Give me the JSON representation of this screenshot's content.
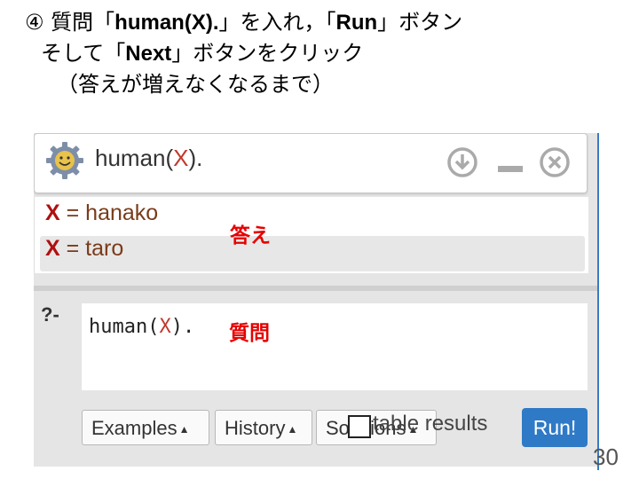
{
  "slide": {
    "step_mark": "④",
    "line1_a": "質問「",
    "line1_b": "human(X).",
    "line1_c": "」を入れ，「",
    "line1_d": "Run",
    "line1_e": "」ボタン",
    "line2_a": "そして「",
    "line2_b": "Next",
    "line2_c": "」ボタンをクリック",
    "line3": "（答えが増えなくなるまで）",
    "page_number": "30"
  },
  "query_header": {
    "pred": "human(",
    "var": "X",
    "close": ")."
  },
  "answers": [
    {
      "var": "X",
      "eq": " = hanako"
    },
    {
      "var": "X",
      "eq": " = taro"
    }
  ],
  "annotations": {
    "answer_tag": "答え",
    "question_tag": "質問"
  },
  "editor": {
    "prompt": "?-",
    "pred": "human",
    "open": "(",
    "var": "X",
    "close": ")."
  },
  "toolbar": {
    "examples": "Examples",
    "history": "History",
    "solutions": "Solutions",
    "table_results": "table results",
    "run": "Run!"
  },
  "colors": {
    "variable": "#c0392b",
    "annotation": "#e60000",
    "run_button": "#2f7ac6"
  },
  "icons": [
    "gear-icon",
    "download-icon",
    "minimize-icon",
    "close-icon",
    "caret-up-icon",
    "checkbox-icon"
  ]
}
